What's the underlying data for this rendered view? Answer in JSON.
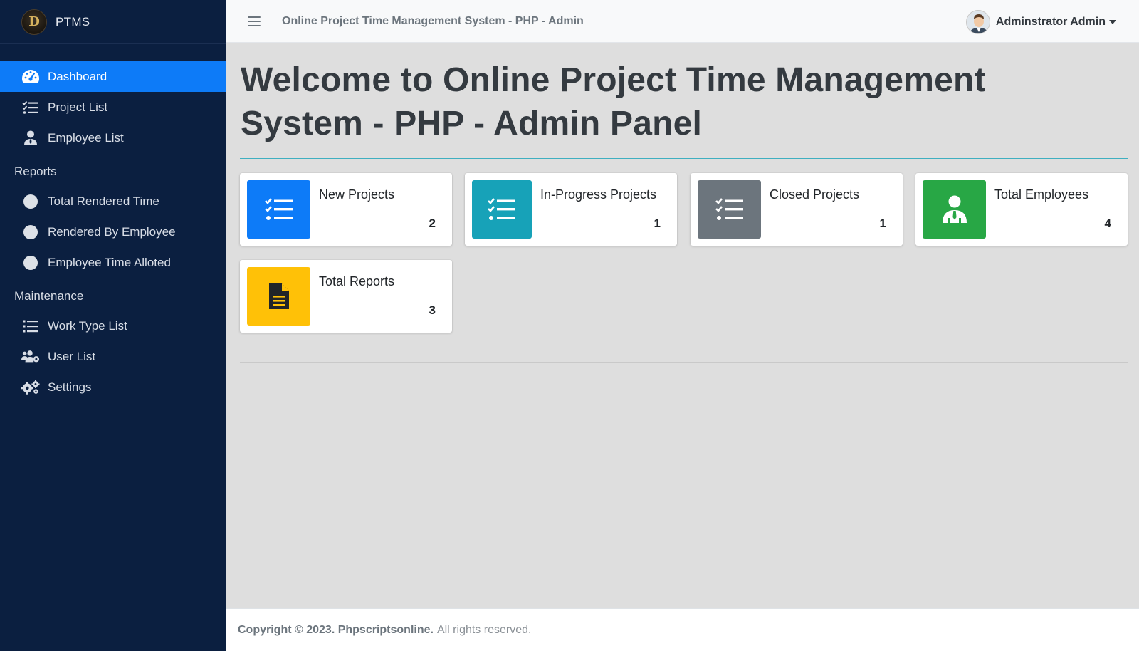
{
  "brand": {
    "logo_letter": "D",
    "name": "PTMS"
  },
  "sidebar": {
    "items": [
      {
        "label": "Dashboard",
        "icon": "dashboard-gauge-icon",
        "active": true
      },
      {
        "label": "Project List",
        "icon": "tasks-list-icon"
      },
      {
        "label": "Employee List",
        "icon": "user-tie-icon"
      }
    ],
    "reports_header": "Reports",
    "reports": [
      {
        "label": "Total Rendered Time",
        "icon": "circle-icon"
      },
      {
        "label": "Rendered By Employee",
        "icon": "circle-icon"
      },
      {
        "label": "Employee Time Alloted",
        "icon": "circle-icon"
      }
    ],
    "maintenance_header": "Maintenance",
    "maintenance": [
      {
        "label": "Work Type List",
        "icon": "list-icon"
      },
      {
        "label": "User List",
        "icon": "users-cog-icon"
      },
      {
        "label": "Settings",
        "icon": "cogs-icon"
      }
    ]
  },
  "topbar": {
    "title": "Online Project Time Management System - PHP - Admin",
    "user_name": "Adminstrator Admin"
  },
  "main": {
    "welcome": "Welcome to Online Project Time Management System - PHP - Admin Panel",
    "cards": [
      {
        "label": "New Projects",
        "value": "2",
        "color": "#0d7bf8",
        "icon": "tasks-icon"
      },
      {
        "label": "In-Progress Projects",
        "value": "1",
        "color": "#17a2b8",
        "icon": "tasks-icon"
      },
      {
        "label": "Closed Projects",
        "value": "1",
        "color": "#6c757d",
        "icon": "tasks-icon"
      },
      {
        "label": "Total Employees",
        "value": "4",
        "color": "#28a745",
        "icon": "user-tie-icon"
      },
      {
        "label": "Total Reports",
        "value": "3",
        "color": "#ffc107",
        "icon": "file-alt-icon"
      }
    ]
  },
  "footer": {
    "copyright": "Copyright © 2023. Phpscriptsonline.",
    "rights": "All rights reserved."
  }
}
